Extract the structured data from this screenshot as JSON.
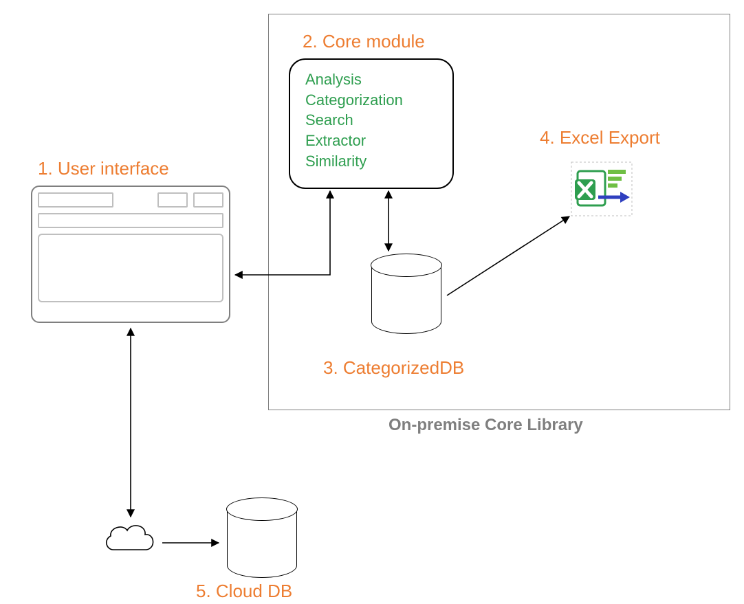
{
  "labels": {
    "ui": "1. User interface",
    "core": "2. Core module",
    "db": "3. CategorizedDB",
    "excel": "4. Excel Export",
    "cloud": "5. Cloud DB",
    "library": "On-premise Core Library"
  },
  "core_module_items": [
    "Analysis",
    "Categorization",
    "Search",
    "Extractor",
    "Similarity"
  ],
  "colors": {
    "accent": "#ed7d31",
    "module_text": "#2e9e4f",
    "frame": "#7f7f7f"
  }
}
